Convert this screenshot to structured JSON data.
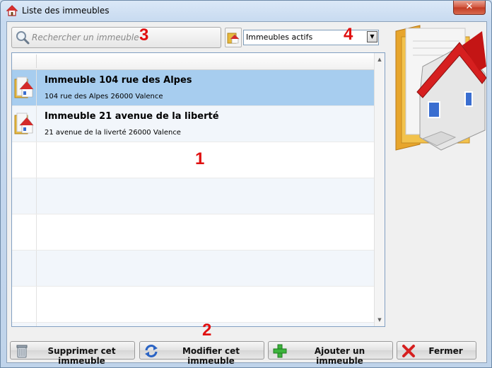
{
  "window": {
    "title": "Liste des immeubles",
    "close_label": "✕"
  },
  "search": {
    "placeholder": "Rechercher un immeuble"
  },
  "filter": {
    "selected": "Immeubles actifs"
  },
  "list": {
    "rows": [
      {
        "title": "Immeuble 104 rue des Alpes",
        "address": "104 rue des Alpes 26000 Valence",
        "selected": true
      },
      {
        "title": "Immeuble 21 avenue de la liberté",
        "address": "21 avenue de la liverté 26000 Valence",
        "selected": false
      }
    ],
    "empty_rows": 6
  },
  "annotations": {
    "n1": "1",
    "n2": "2",
    "n3": "3",
    "n4": "4"
  },
  "buttons": {
    "delete": "Supprimer cet immeuble",
    "edit": "Modifier cet immeuble",
    "add": "Ajouter un immeuble",
    "close": "Fermer"
  },
  "icons": {
    "title": "house-icon",
    "search": "magnifier-icon",
    "filter": "building-folder-icon",
    "row": "building-folder-icon",
    "delete": "recycle-bin-icon",
    "edit": "refresh-arrows-icon",
    "add": "green-plus-icon",
    "close": "red-x-icon"
  },
  "colors": {
    "selection": "#a7cdef",
    "annotation": "#e01010"
  }
}
